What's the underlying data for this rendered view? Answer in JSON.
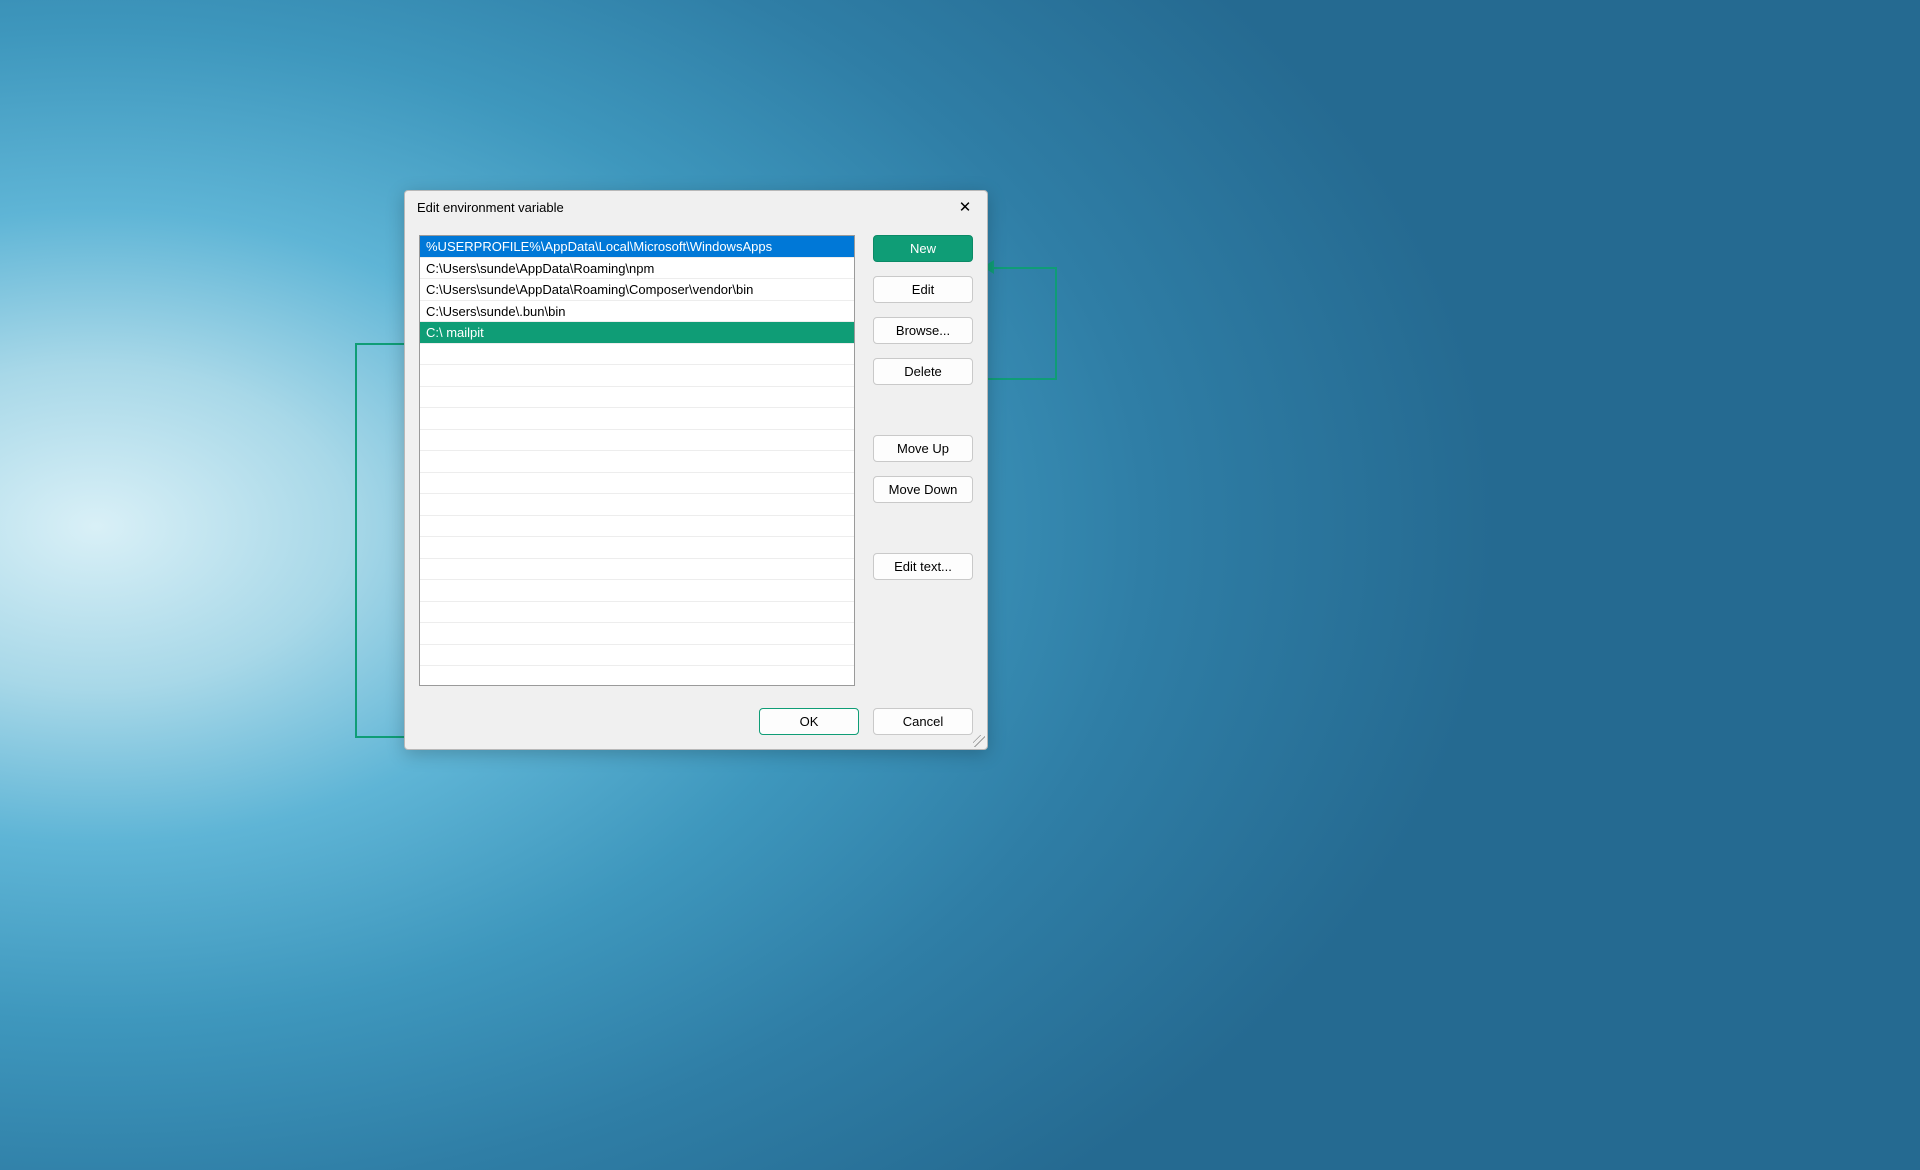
{
  "dialog": {
    "title": "Edit environment variable",
    "paths": [
      {
        "text": "%USERPROFILE%\\AppData\\Local\\Microsoft\\WindowsApps",
        "state": "selected-blue"
      },
      {
        "text": "C:\\Users\\sunde\\AppData\\Roaming\\npm",
        "state": ""
      },
      {
        "text": "C:\\Users\\sunde\\AppData\\Roaming\\Composer\\vendor\\bin",
        "state": ""
      },
      {
        "text": "C:\\Users\\sunde\\.bun\\bin",
        "state": ""
      },
      {
        "text": "C:\\ mailpit",
        "state": "selected-green"
      }
    ],
    "blank_rows": 15,
    "buttons": {
      "new": "New",
      "edit": "Edit",
      "browse": "Browse...",
      "delete": "Delete",
      "moveup": "Move Up",
      "movedown": "Move Down",
      "edittext": "Edit text...",
      "ok": "OK",
      "cancel": "Cancel"
    }
  },
  "colors": {
    "accent": "#0f9d76",
    "selection": "#0078d7"
  }
}
